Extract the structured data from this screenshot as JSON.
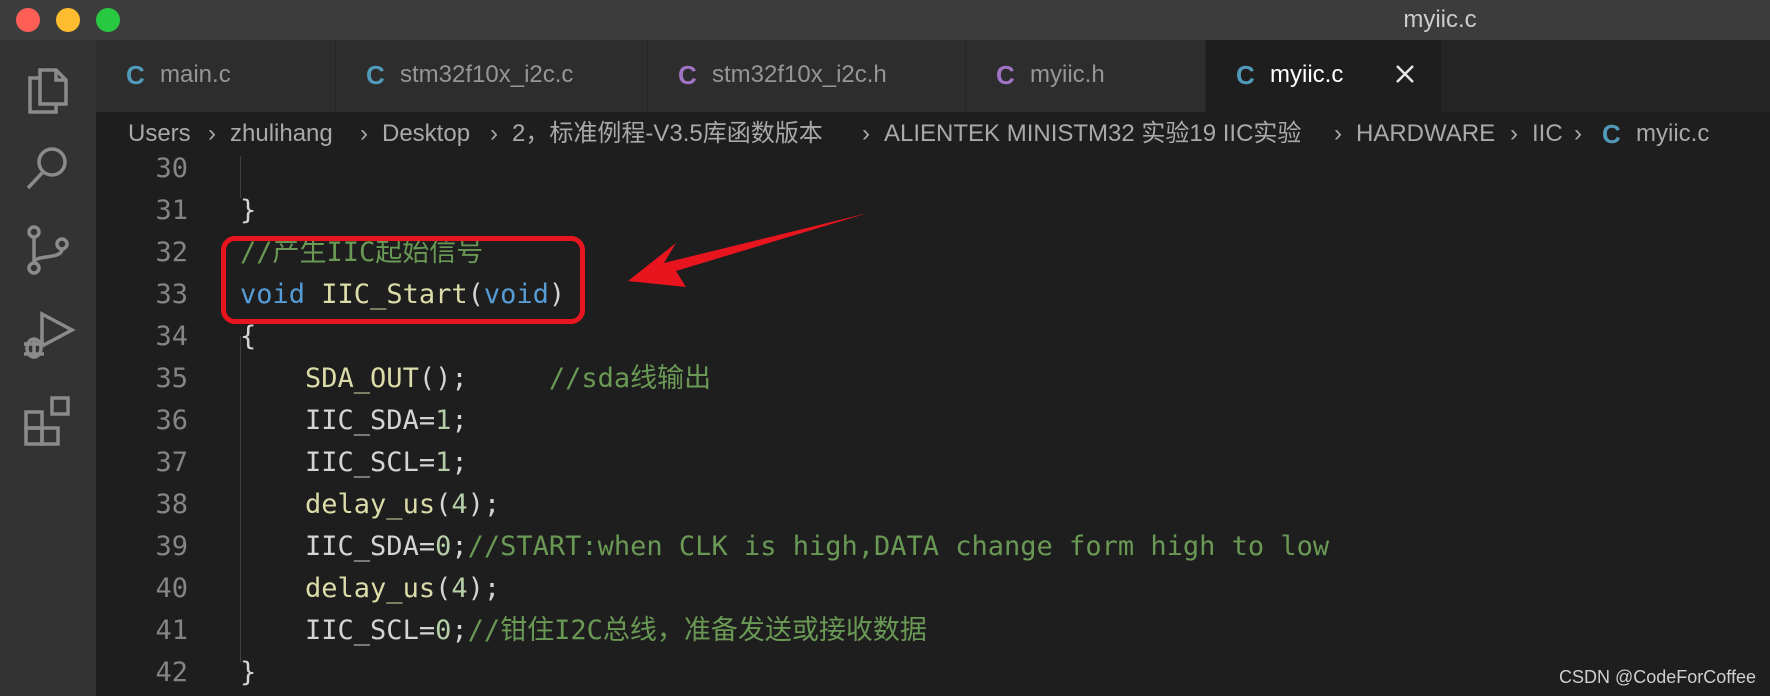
{
  "window": {
    "title": "myiic.c"
  },
  "colors": {
    "c_icon": "#519aba",
    "h_icon": "#a074c4",
    "highlight": "#e8141e"
  },
  "activity_bar": {
    "icons": [
      "files-icon",
      "search-icon",
      "source-control-icon",
      "run-debug-icon",
      "extensions-icon"
    ]
  },
  "tabs": [
    {
      "icon": "C",
      "label": "main.c",
      "active": false
    },
    {
      "icon": "C",
      "label": "stm32f10x_i2c.c",
      "active": false
    },
    {
      "icon": "C",
      "label": "stm32f10x_i2c.h",
      "active": false
    },
    {
      "icon": "C",
      "label": "myiic.h",
      "active": false
    },
    {
      "icon": "C",
      "label": "myiic.c",
      "active": true
    }
  ],
  "breadcrumb": {
    "items": [
      "Users",
      "zhulihang",
      "Desktop",
      "2，标准例程-V3.5库函数版本",
      "ALIENTEK MINISTM32 实验19 IIC实验",
      "HARDWARE",
      "IIC"
    ],
    "file_icon": "C",
    "file": "myiic.c"
  },
  "code": {
    "line_numbers": [
      "30",
      "31",
      "32",
      "33",
      "34",
      "35",
      "36",
      "37",
      "38",
      "39",
      "40",
      "41",
      "42"
    ],
    "l31": "}",
    "l32": "//产生IIC起始信号",
    "l33_kw1": "void",
    "l33_fn": "IIC_Start",
    "l33_p1": "(",
    "l33_kw2": "void",
    "l33_p2": ")",
    "l34": "{",
    "l35_fn": "SDA_OUT",
    "l35_p": "();",
    "l35_cm": "//sda线输出",
    "l36_a": "IIC_SDA=",
    "l36_n": "1",
    "l36_b": ";",
    "l37_a": "IIC_SCL=",
    "l37_n": "1",
    "l37_b": ";",
    "l38_fn": "delay_us",
    "l38_p1": "(",
    "l38_n": "4",
    "l38_p2": ");",
    "l39_a": "IIC_SDA=",
    "l39_n": "0",
    "l39_b": ";",
    "l39_cm": "//START:when CLK is high,DATA change form high to low",
    "l40_fn": "delay_us",
    "l40_p1": "(",
    "l40_n": "4",
    "l40_p2": ");",
    "l41_a": "IIC_SCL=",
    "l41_n": "0",
    "l41_b": ";",
    "l41_cm": "//钳住I2C总线，准备发送或接收数据",
    "l42": "}"
  },
  "watermark": "CSDN @CodeForCoffee"
}
